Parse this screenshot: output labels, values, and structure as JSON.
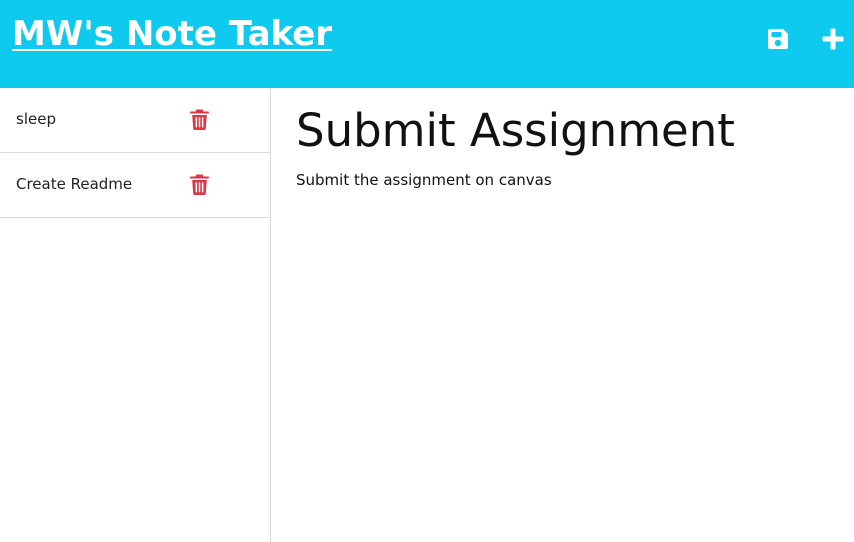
{
  "header": {
    "brand": "MW's Note Taker",
    "save_icon": "floppy-disk-icon",
    "new_icon": "plus-icon",
    "background_color": "#0fcaef"
  },
  "sidebar": {
    "notes": [
      {
        "title": "sleep",
        "delete_icon": "trash-icon"
      },
      {
        "title": "Create Readme",
        "delete_icon": "trash-icon"
      }
    ],
    "delete_color": "#dc3545"
  },
  "editor": {
    "title": "Submit Assignment",
    "text": "Submit the assignment on canvas"
  }
}
